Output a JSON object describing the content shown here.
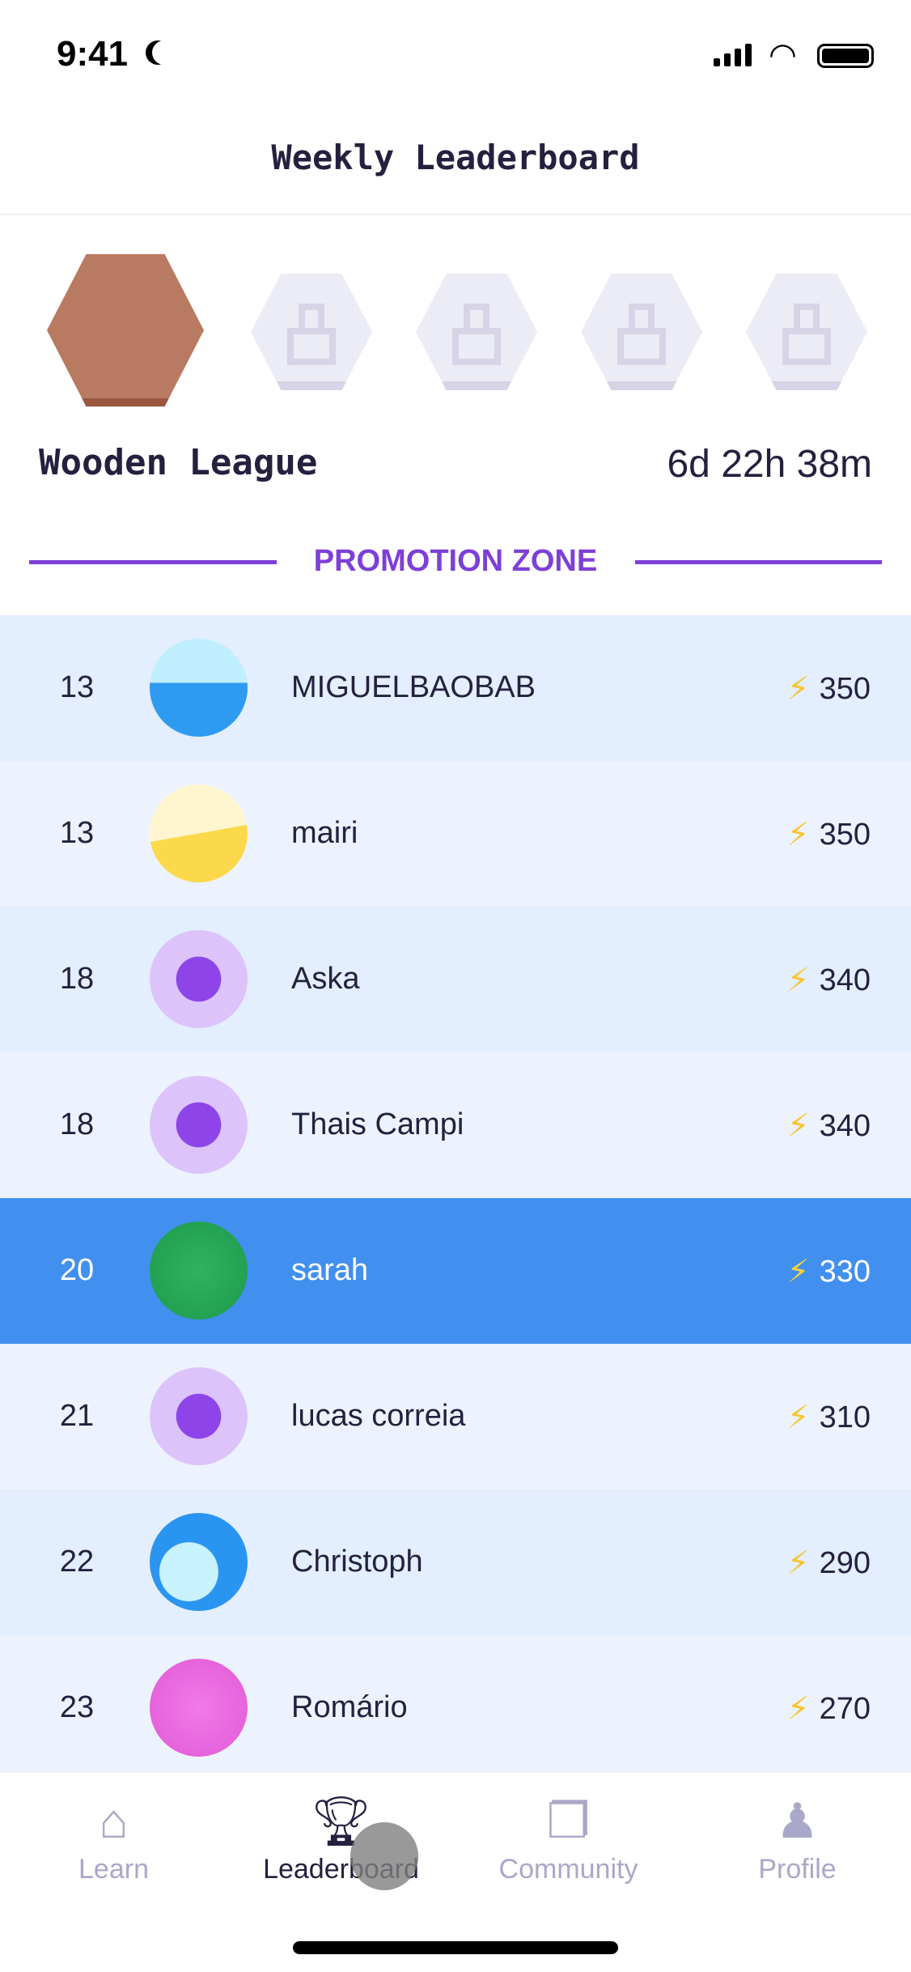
{
  "status_bar": {
    "time": "9:41"
  },
  "header": {
    "title": "Weekly Leaderboard"
  },
  "league": {
    "name": "Wooden League",
    "time_left": "6d 22h 38m",
    "badges": [
      "wooden-league-badge",
      "locked",
      "locked",
      "locked",
      "locked"
    ]
  },
  "promotion_zone": {
    "label": "PROMOTION ZONE",
    "color": "#7e3fd8"
  },
  "rows": [
    {
      "rank": "13",
      "name": "MIGUELBAOBAB",
      "xp": "350",
      "avatar": "water-avatar"
    },
    {
      "rank": "13",
      "name": "mairi",
      "xp": "350",
      "avatar": "sand-avatar"
    },
    {
      "rank": "18",
      "name": "Aska",
      "xp": "340",
      "avatar": "cube-avatar"
    },
    {
      "rank": "18",
      "name": "Thais Campi",
      "xp": "340",
      "avatar": "cube-avatar"
    },
    {
      "rank": "20",
      "name": "sarah",
      "xp": "330",
      "avatar": "binary-avatar",
      "current_user": true
    },
    {
      "rank": "21",
      "name": "lucas correia",
      "xp": "310",
      "avatar": "cube-avatar"
    },
    {
      "rank": "22",
      "name": "Christoph",
      "xp": "290",
      "avatar": "wave-avatar"
    },
    {
      "rank": "23",
      "name": "Romário",
      "xp": "270",
      "avatar": "pink-pattern-avatar"
    }
  ],
  "tabs": [
    {
      "label": "Learn"
    },
    {
      "label": "Leaderboard",
      "active": true
    },
    {
      "label": "Community"
    },
    {
      "label": "Profile"
    }
  ],
  "colors": {
    "highlight_row": "#4190f0",
    "row_a": "#e3eefe",
    "row_b": "#edf3fe",
    "xp_bolt": "#f6c531"
  }
}
